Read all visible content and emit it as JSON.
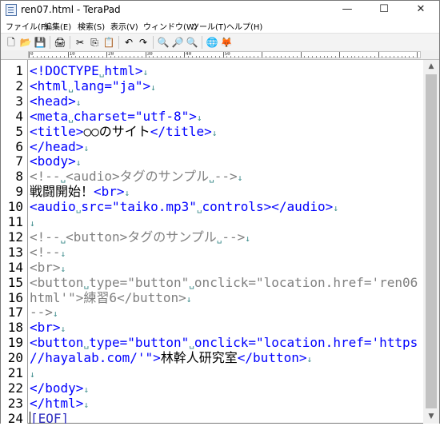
{
  "window": {
    "title": "ren07.html - TeraPad"
  },
  "caption": {
    "minimize": "—",
    "maximize": "☐",
    "close": "✕"
  },
  "menu": [
    "ファイル(F)",
    "編集(E)",
    "検索(S)",
    "表示(V)",
    "ウィンドウ(W)",
    "ツール(T)",
    "ヘルプ(H)"
  ],
  "toolbar": {
    "icons": [
      "new-file-icon",
      "open-folder-icon",
      "save-icon",
      "print-icon",
      "cut-icon",
      "copy-icon",
      "paste-icon",
      "undo-icon",
      "redo-icon",
      "find-icon",
      "find-next-icon",
      "find-prev-icon",
      "browser-preview-icon",
      "firefox-icon"
    ],
    "glyphs": [
      "🗋",
      "📂",
      "💾",
      "🖨",
      "✂",
      "⎘",
      "📋",
      "↶",
      "↷",
      "🔍",
      "🔎",
      "🔍",
      "🌐",
      "🦊"
    ]
  },
  "ruler": {
    "labels": [
      "0",
      "10",
      "20",
      "30",
      "40",
      "50"
    ]
  },
  "editor": {
    "line_numbers": [
      "1",
      "2",
      "3",
      "4",
      "5",
      "6",
      "7",
      "8",
      "9",
      "10",
      "11",
      "12",
      "13",
      "14",
      "15",
      "16",
      "17",
      "18",
      "19",
      "20",
      "21",
      "22",
      "23",
      "24"
    ],
    "lines": [
      [
        {
          "t": "<!DOCTYPE",
          "c": "tag"
        },
        {
          "t": "␣",
          "c": "mk"
        },
        {
          "t": "html>",
          "c": "tag"
        },
        {
          "t": "↓",
          "c": "mk"
        }
      ],
      [
        {
          "t": "<html",
          "c": "tag"
        },
        {
          "t": "␣",
          "c": "mk"
        },
        {
          "t": "lang=\"ja\">",
          "c": "tag"
        },
        {
          "t": "↓",
          "c": "mk"
        }
      ],
      [
        {
          "t": "<head>",
          "c": "tag"
        },
        {
          "t": "↓",
          "c": "mk"
        }
      ],
      [
        {
          "t": "<meta",
          "c": "tag"
        },
        {
          "t": "␣",
          "c": "mk"
        },
        {
          "t": "charset=\"utf-8\">",
          "c": "tag"
        },
        {
          "t": "↓",
          "c": "mk"
        }
      ],
      [
        {
          "t": "<title>",
          "c": "tag"
        },
        {
          "t": "○○のサイト",
          "c": "txt"
        },
        {
          "t": "</title>",
          "c": "tag"
        },
        {
          "t": "↓",
          "c": "mk"
        }
      ],
      [
        {
          "t": "</head>",
          "c": "tag"
        },
        {
          "t": "↓",
          "c": "mk"
        }
      ],
      [
        {
          "t": "<body>",
          "c": "tag"
        },
        {
          "t": "↓",
          "c": "mk"
        }
      ],
      [
        {
          "t": "<!--",
          "c": "cmt"
        },
        {
          "t": "␣",
          "c": "mk"
        },
        {
          "t": "<audio>タグのサンプル",
          "c": "cmt"
        },
        {
          "t": "␣",
          "c": "mk"
        },
        {
          "t": "-->",
          "c": "cmt"
        },
        {
          "t": "↓",
          "c": "mk"
        }
      ],
      [
        {
          "t": "戦闘開始！",
          "c": "txt"
        },
        {
          "t": "<br>",
          "c": "tag"
        },
        {
          "t": "↓",
          "c": "mk"
        }
      ],
      [
        {
          "t": "<audio",
          "c": "tag"
        },
        {
          "t": "␣",
          "c": "mk"
        },
        {
          "t": "src=\"taiko.mp3\"",
          "c": "tag"
        },
        {
          "t": "␣",
          "c": "mk"
        },
        {
          "t": "controls></audio>",
          "c": "tag"
        },
        {
          "t": "↓",
          "c": "mk"
        }
      ],
      [
        {
          "t": "↓",
          "c": "mk"
        }
      ],
      [
        {
          "t": "<!--",
          "c": "cmt"
        },
        {
          "t": "␣",
          "c": "mk"
        },
        {
          "t": "<button>タグのサンプル",
          "c": "cmt"
        },
        {
          "t": "␣",
          "c": "mk"
        },
        {
          "t": "-->",
          "c": "cmt"
        },
        {
          "t": "↓",
          "c": "mk"
        }
      ],
      [
        {
          "t": "<!--",
          "c": "cmt"
        },
        {
          "t": "↓",
          "c": "mk"
        }
      ],
      [
        {
          "t": "<br>",
          "c": "cmt"
        },
        {
          "t": "↓",
          "c": "mk"
        }
      ],
      [
        {
          "t": "<button",
          "c": "cmt"
        },
        {
          "t": "␣",
          "c": "mk"
        },
        {
          "t": "type=\"button\"",
          "c": "cmt"
        },
        {
          "t": "␣",
          "c": "mk"
        },
        {
          "t": "onclick=\"location.href='ren06.",
          "c": "cmt"
        }
      ],
      [
        {
          "t": "html'\">練習6</button>",
          "c": "cmt"
        },
        {
          "t": "↓",
          "c": "mk"
        }
      ],
      [
        {
          "t": "-->",
          "c": "cmt"
        },
        {
          "t": "↓",
          "c": "mk"
        }
      ],
      [
        {
          "t": "<br>",
          "c": "tag"
        },
        {
          "t": "↓",
          "c": "mk"
        }
      ],
      [
        {
          "t": "<button",
          "c": "tag"
        },
        {
          "t": "␣",
          "c": "mk"
        },
        {
          "t": "type=\"button\"",
          "c": "tag"
        },
        {
          "t": "␣",
          "c": "mk"
        },
        {
          "t": "onclick=\"location.href='https:",
          "c": "tag"
        }
      ],
      [
        {
          "t": "//hayalab.com/'\">",
          "c": "tag"
        },
        {
          "t": "林幹人研究室",
          "c": "txt"
        },
        {
          "t": "</button>",
          "c": "tag"
        },
        {
          "t": "↓",
          "c": "mk"
        }
      ],
      [
        {
          "t": "↓",
          "c": "mk"
        }
      ],
      [
        {
          "t": "</body>",
          "c": "tag"
        },
        {
          "t": "↓",
          "c": "mk"
        }
      ],
      [
        {
          "t": "</html>",
          "c": "tag"
        },
        {
          "t": "↓",
          "c": "mk"
        }
      ],
      [
        {
          "t": "[EOF]",
          "c": "eof"
        }
      ]
    ]
  },
  "scrollbar": {
    "up": "▲",
    "down": "▼"
  }
}
